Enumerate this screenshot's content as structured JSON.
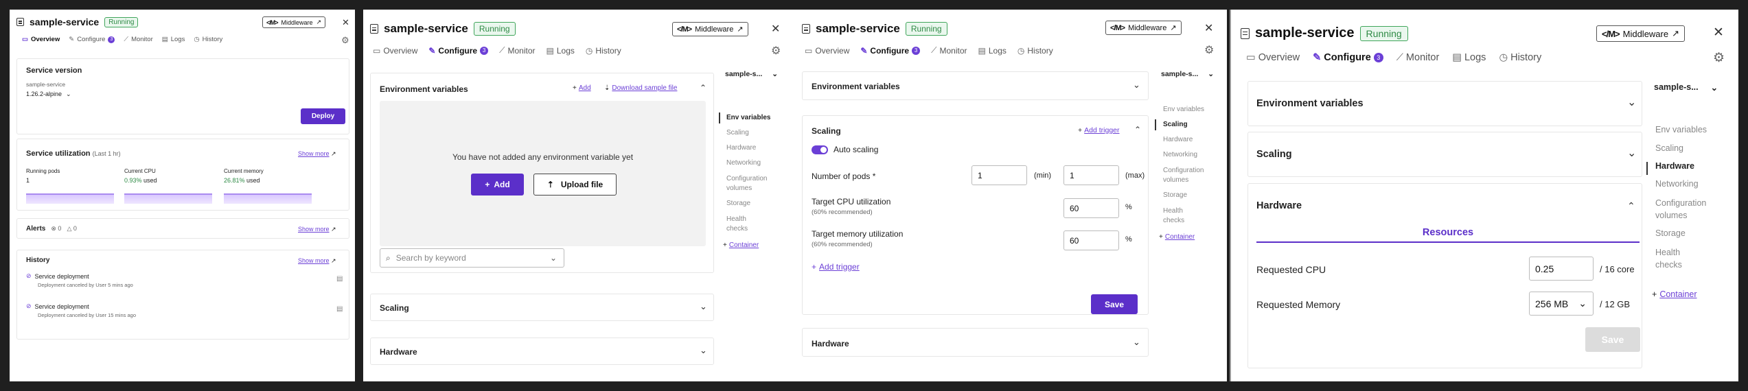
{
  "common": {
    "service_name": "sample-service",
    "status": "Running",
    "middleware_label": "Middleware",
    "middleware_logo": "</M>",
    "close_glyph": "✕",
    "gear_glyph": "⚙",
    "tabs": [
      "Overview",
      "Configure",
      "Monitor",
      "Logs",
      "History"
    ],
    "configure_count": "3",
    "accent_color": "#6b3fd6",
    "status_color": "#2e8a45"
  },
  "overview": {
    "service_version": {
      "title": "Service version",
      "subtitle": "sample-service",
      "version": "1.26.2-alpine",
      "deploy_label": "Deploy"
    },
    "utilization": {
      "title": "Service utilization",
      "period": "(Last 1 hr)",
      "show_more": "Show more",
      "running_pods_label": "Running pods",
      "running_pods_value": "1",
      "cpu_label": "Current CPU",
      "cpu_value": "0.93%",
      "cpu_suffix": "used",
      "memory_label": "Current memory",
      "memory_value": "26.81%",
      "memory_suffix": "used"
    },
    "alerts": {
      "title": "Alerts",
      "count_a": "0",
      "count_b": "0",
      "show_more": "Show more"
    },
    "history": {
      "title": "History",
      "show_more": "Show more",
      "items": [
        {
          "title": "Service deployment",
          "detail": "Deployment canceled by User 5 mins ago"
        },
        {
          "title": "Service deployment",
          "detail": "Deployment canceled by User 15 mins ago"
        }
      ]
    }
  },
  "configure_env": {
    "env_title": "Environment variables",
    "add_link": "Add",
    "download_link": "Download sample file",
    "empty_text": "You have not added any environment variable yet",
    "add_button": "Add",
    "upload_button": "Upload file",
    "search_placeholder": "Search by keyword",
    "scaling_title": "Scaling",
    "hardware_title": "Hardware",
    "side_select": "sample-s...",
    "side_items": [
      "Env variables",
      "Scaling",
      "Hardware",
      "Networking",
      "Configuration volumes",
      "Storage",
      "Health checks"
    ],
    "container_link": "Container"
  },
  "configure_scaling": {
    "env_title": "Environment variables",
    "scaling_title": "Scaling",
    "add_trigger_link": "Add trigger",
    "auto_scaling_label": "Auto scaling",
    "pods_label": "Number of pods *",
    "pods_min_value": "1",
    "pods_min_unit": "(min)",
    "pods_max_value": "1",
    "pods_max_unit": "(max)",
    "cpu_label": "Target CPU utilization",
    "cpu_hint": "(60% recommended)",
    "cpu_value": "60",
    "percent": "%",
    "memory_label": "Target memory utilization",
    "memory_hint": "(60% recommended)",
    "memory_value": "60",
    "add_trigger_button": "Add trigger",
    "save_label": "Save",
    "hardware_title": "Hardware",
    "side_select": "sample-s...",
    "side_items": [
      "Env variables",
      "Scaling",
      "Hardware",
      "Networking",
      "Configuration volumes",
      "Storage",
      "Health checks"
    ],
    "container_link": "Container"
  },
  "configure_hardware": {
    "env_title": "Environment variables",
    "scaling_title": "Scaling",
    "hardware_title": "Hardware",
    "resources_tab": "Resources",
    "cpu_label": "Requested CPU",
    "cpu_value": "0.25",
    "cpu_limit": "/ 16 core",
    "memory_label": "Requested Memory",
    "memory_value": "256 MB",
    "memory_limit": "/ 12 GB",
    "save_label": "Save",
    "side_select": "sample-s...",
    "side_items": [
      "Env variables",
      "Scaling",
      "Hardware",
      "Networking",
      "Configuration volumes",
      "Storage",
      "Health checks"
    ],
    "container_link": "Container"
  }
}
